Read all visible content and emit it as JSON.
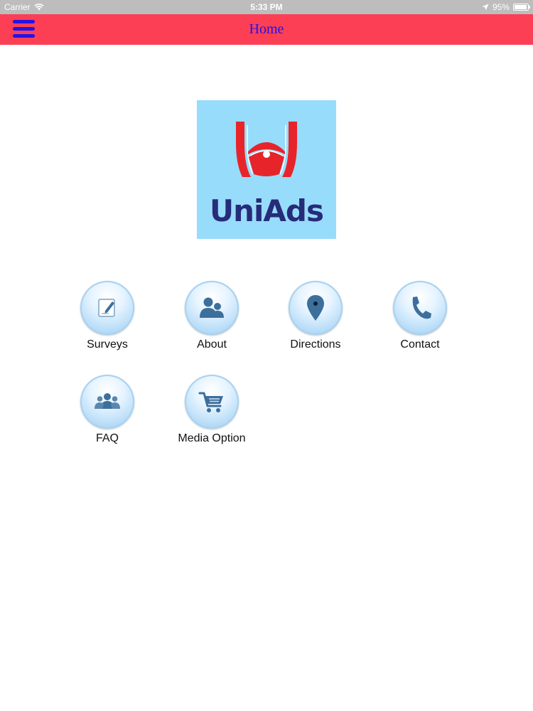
{
  "status_bar": {
    "carrier": "Carrier",
    "time": "5:33 PM",
    "battery": "95%",
    "battery_level": 0.95
  },
  "nav_bar": {
    "title": "Home",
    "background": "#fc3f55",
    "accent": "#2512e6"
  },
  "logo": {
    "text": "UniAds",
    "background": "#97dcfa"
  },
  "tiles": [
    {
      "label": "Surveys",
      "icon": "edit-document-icon"
    },
    {
      "label": "About",
      "icon": "users-icon"
    },
    {
      "label": "Directions",
      "icon": "map-pin-icon"
    },
    {
      "label": "Contact",
      "icon": "phone-icon"
    },
    {
      "label": "FAQ",
      "icon": "group-icon"
    },
    {
      "label": "Media Option",
      "icon": "shopping-cart-icon"
    }
  ]
}
